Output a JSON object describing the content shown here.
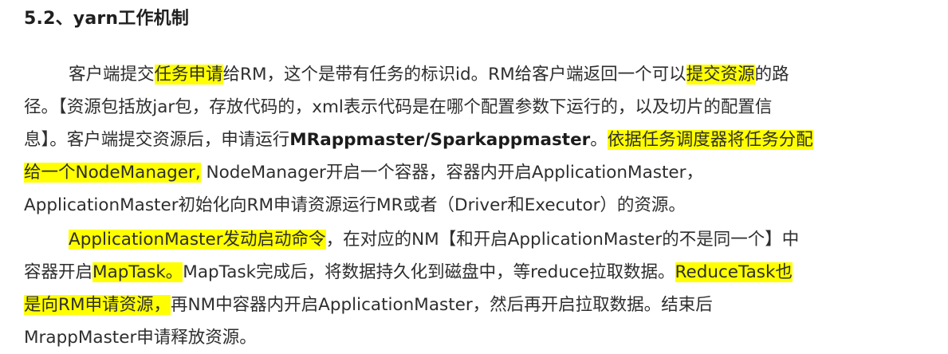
{
  "heading": "5.2、yarn工作机制",
  "paragraph1": {
    "line1": {
      "a": "客户端提交",
      "hl1": "任务申请",
      "b": "给RM，这个是带有任务的标识id。RM给客户端返回一个可以",
      "hl2": "提交资源",
      "c": "的路"
    },
    "line2": {
      "a": "径。【资源包括放jar包，存放代码的，xml表示代码是在哪个配置参数下运行的，以及切片的配置信"
    },
    "line3": {
      "a": "息】。客户端提交资源后，申请运行",
      "bold": "MRappmaster/Sparkappmaster",
      "b": "。",
      "hl": "依据任务调度器将任务分配"
    },
    "line4": {
      "hl": "给一个NodeManager,",
      "a": " NodeManager开启一个容器，容器内开启ApplicationMaster，"
    },
    "line5": {
      "a": "ApplicationMaster初始化向RM申请资源运行MR或者（Driver和Executor）的资源。"
    }
  },
  "paragraph2": {
    "line1": {
      "hl": "ApplicationMaster发动启动命令",
      "a": "，在对应的NM【和开启ApplicationMaster的不是同一个】中"
    },
    "line2": {
      "a": "容器开启",
      "hl1": "MapTask。",
      "b": "MapTask完成后，将数据持久化到磁盘中，等reduce拉取数据。",
      "hl2": "ReduceTask也"
    },
    "line3": {
      "hl": "是向RM申请资源，",
      "a": "再NM中容器内开启ApplicationMaster，然后再开启拉取数据。结束后"
    },
    "line4": {
      "a": "MrappMaster申请释放资源。"
    }
  },
  "colors": {
    "highlight": "#ffff00",
    "text": "#2e2e2e",
    "background": "#ffffff"
  }
}
